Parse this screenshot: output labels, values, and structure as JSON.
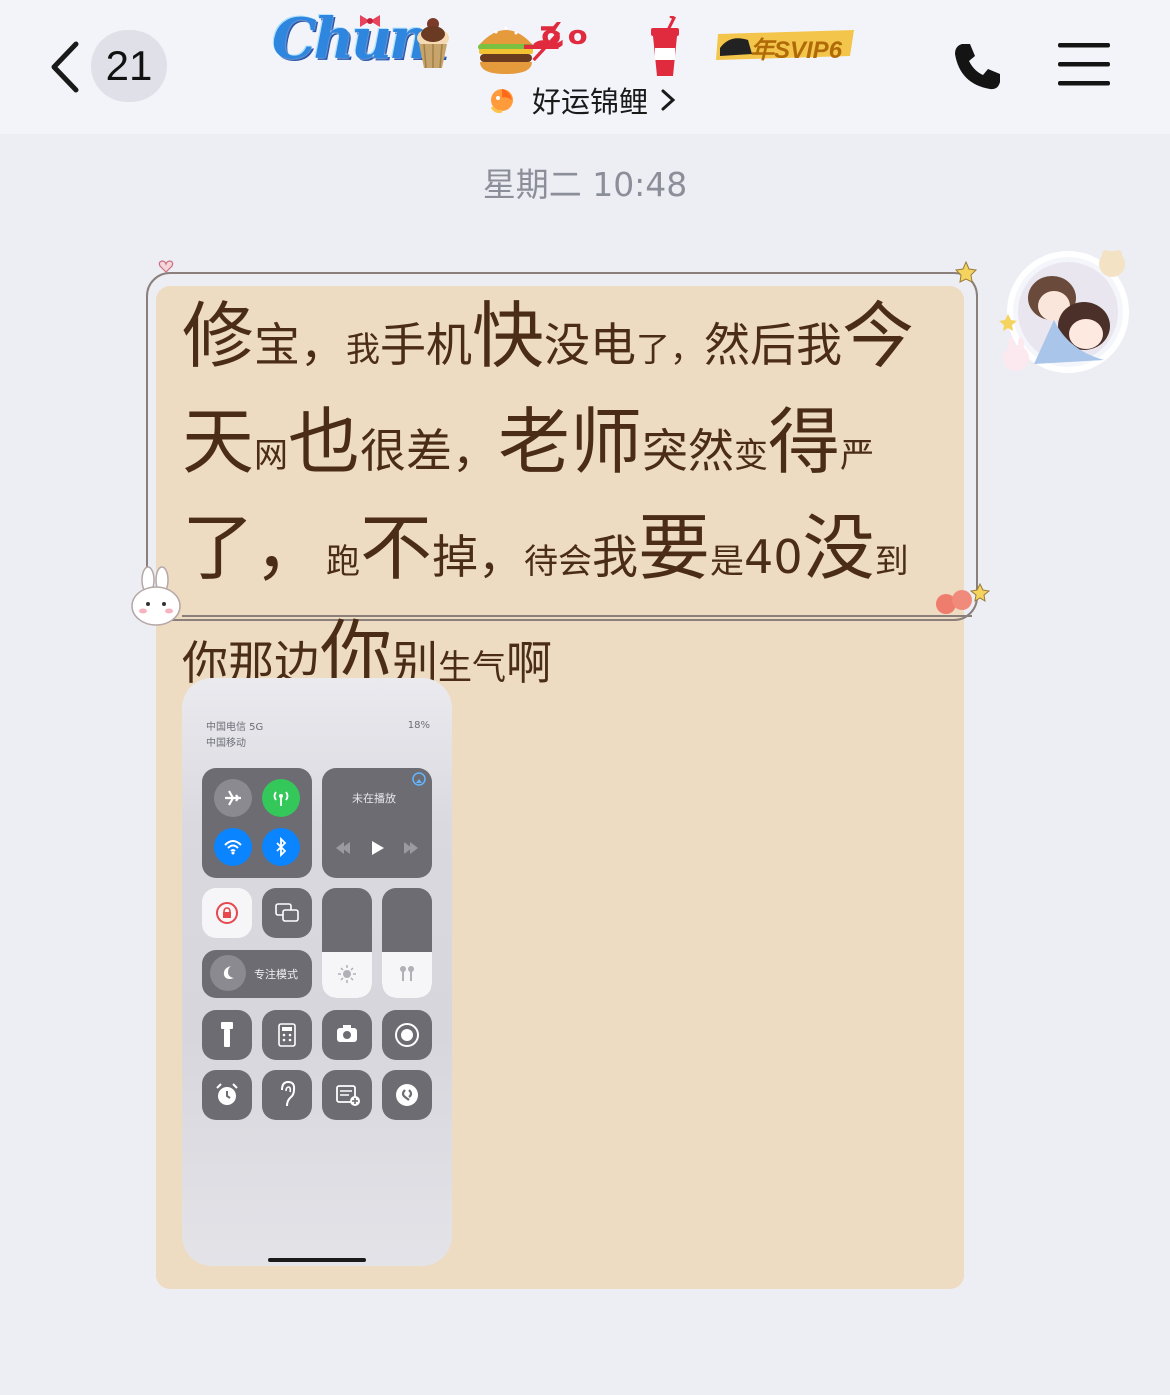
{
  "header": {
    "unread_count": "21",
    "nickname_text": "Chum",
    "nickname_eyes": "ᵒ̴̶̷᷄ᵒ",
    "svip_label": "年SVIP6",
    "status_text": "好运锦鲤"
  },
  "chat": {
    "timestamp": "星期二 10:48",
    "message": {
      "segments": [
        {
          "t": "修",
          "s": "b"
        },
        {
          "t": "宝，",
          "s": "m"
        },
        {
          "t": "我",
          "s": "s"
        },
        {
          "t": "手机",
          "s": "m"
        },
        {
          "t": "快",
          "s": "b"
        },
        {
          "t": "没电",
          "s": "m"
        },
        {
          "t": "了，",
          "s": "s"
        },
        {
          "t": "然后我",
          "s": "m"
        },
        {
          "t": "今天",
          "s": "b"
        },
        {
          "t": "网",
          "s": "s"
        },
        {
          "t": "也",
          "s": "b"
        },
        {
          "t": "很差，",
          "s": "m"
        },
        {
          "t": "老师",
          "s": "b"
        },
        {
          "t": "突然",
          "s": "m"
        },
        {
          "t": "变",
          "s": "s"
        },
        {
          "t": "得",
          "s": "b"
        },
        {
          "t": "严",
          "s": "s"
        },
        {
          "t": "了，",
          "s": "b"
        },
        {
          "t": "跑",
          "s": "s"
        },
        {
          "t": "不",
          "s": "b"
        },
        {
          "t": "掉，",
          "s": "m"
        },
        {
          "t": "待会",
          "s": "s"
        },
        {
          "t": "我",
          "s": "m"
        },
        {
          "t": "要",
          "s": "b"
        },
        {
          "t": "是",
          "s": "s"
        },
        {
          "t": "40",
          "s": "m"
        },
        {
          "t": "没",
          "s": "b"
        },
        {
          "t": "到",
          "s": "s"
        },
        {
          "t": "你那边",
          "s": "m"
        },
        {
          "t": "你",
          "s": "b"
        },
        {
          "t": "别",
          "s": "m"
        },
        {
          "t": "生气",
          "s": "s"
        },
        {
          "t": "啊",
          "s": "m"
        }
      ]
    },
    "image": {
      "carrier_1": "中国电信 5G",
      "carrier_2": "中国移动",
      "battery": "18%",
      "now_playing": "未在播放",
      "focus_mode": "专注模式"
    }
  },
  "colors": {
    "bubble": "#eddbc2",
    "text": "#4a2c17",
    "accent_blue": "#2f86df",
    "green": "#34c759",
    "ios_blue": "#0a84ff"
  }
}
